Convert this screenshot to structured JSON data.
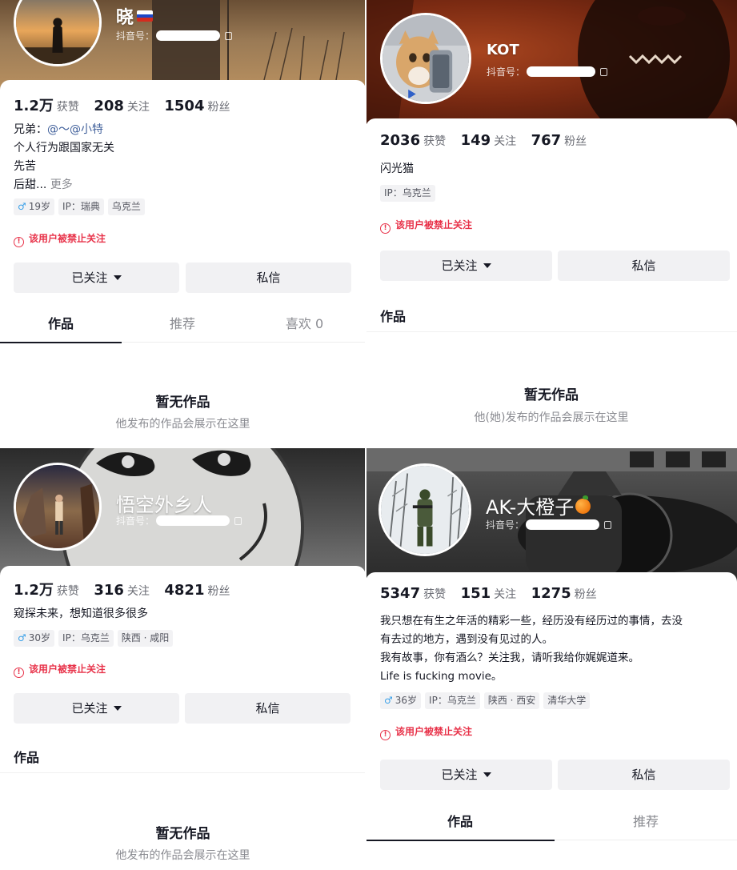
{
  "profiles": [
    {
      "nickname": "晓",
      "flag_colors": [
        "#ffffff",
        "#1c47c7",
        "#d52b1e"
      ],
      "douyin_id_label": "抖音号：",
      "stats": [
        {
          "value": "1.2万",
          "label": "获赞"
        },
        {
          "value": "208",
          "label": "关注"
        },
        {
          "value": "1504",
          "label": "粉丝"
        }
      ],
      "bio": {
        "brother_prefix": "兄弟：",
        "brother_mention": "@～@小特",
        "line2": "个人行为跟国家无关",
        "line3": "先苦",
        "line4": "后甜...",
        "more": "更多"
      },
      "tags": {
        "age": "19岁",
        "ip": "IP：瑞典",
        "location": "乌克兰"
      },
      "banned_notice": "该用户被禁止关注",
      "follow_button": "已关注",
      "message_button": "私信",
      "tabs": [
        "作品",
        "推荐",
        "喜欢 0"
      ],
      "empty_title": "暂无作品",
      "empty_subtitle": "他发布的作品会展示在这里"
    },
    {
      "nickname": "KOT",
      "douyin_id_label": "抖音号：",
      "stats": [
        {
          "value": "2036",
          "label": "获赞"
        },
        {
          "value": "149",
          "label": "关注"
        },
        {
          "value": "767",
          "label": "粉丝"
        }
      ],
      "bio": {
        "line1": "闪光猫"
      },
      "tags": {
        "ip": "IP：乌克兰"
      },
      "banned_notice": "该用户被禁止关注",
      "follow_button": "已关注",
      "message_button": "私信",
      "works_label": "作品",
      "empty_title": "暂无作品",
      "empty_subtitle": "他(她)发布的作品会展示在这里"
    },
    {
      "nickname": "悟空外乡人",
      "douyin_id_label": "抖音号：",
      "stats": [
        {
          "value": "1.2万",
          "label": "获赞"
        },
        {
          "value": "316",
          "label": "关注"
        },
        {
          "value": "4821",
          "label": "粉丝"
        }
      ],
      "bio": {
        "line1": "窥探未来，想知道很多很多"
      },
      "tags": {
        "age": "30岁",
        "ip": "IP：乌克兰",
        "location": "陕西 · 咸阳"
      },
      "banned_notice": "该用户被禁止关注",
      "follow_button": "已关注",
      "message_button": "私信",
      "works_label": "作品",
      "empty_title": "暂无作品",
      "empty_subtitle": "他发布的作品会展示在这里"
    },
    {
      "nickname": "AK-大橙子",
      "douyin_id_label": "抖音号：",
      "stats": [
        {
          "value": "5347",
          "label": "获赞"
        },
        {
          "value": "151",
          "label": "关注"
        },
        {
          "value": "1275",
          "label": "粉丝"
        }
      ],
      "bio": {
        "line1": "我只想在有生之年活的精彩一些，经历没有经历过的事情，去没",
        "line2": "有去过的地方，遇到没有见过的人。",
        "line3": "我有故事，你有酒么？关注我，请听我给你娓娓道来。",
        "line4": "Life is fucking movie。"
      },
      "tags": {
        "age": "36岁",
        "ip": "IP：乌克兰",
        "location": "陕西 · 西安",
        "school": "清华大学"
      },
      "banned_notice": "该用户被禁止关注",
      "follow_button": "已关注",
      "message_button": "私信",
      "tabs": [
        "作品",
        "推荐"
      ]
    }
  ],
  "colors": {
    "banned_red": "#e8334a",
    "mention_blue": "#3f5f9a",
    "male_blue": "#3aa0e8",
    "button_bg": "#f1f1f3",
    "tag_bg": "#f2f2f4"
  },
  "icons": [
    "warning-circle-icon",
    "copy-icon",
    "caret-down-icon",
    "male-icon",
    "russia-flag-icon",
    "orange-emoji-icon"
  ]
}
